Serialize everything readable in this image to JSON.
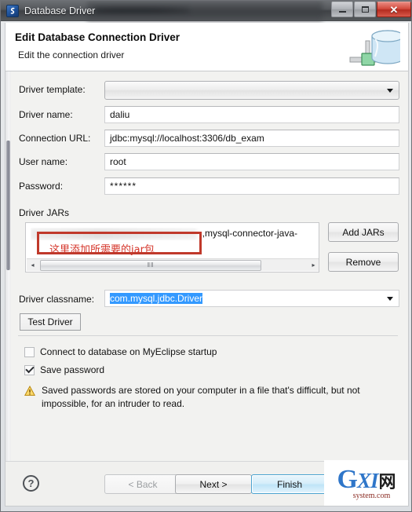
{
  "window": {
    "title": "Database Driver",
    "app_icon": "database-driver-icon",
    "controls": {
      "minimize": "–",
      "restore": "□",
      "close": "✕"
    }
  },
  "header": {
    "title": "Edit Database Connection Driver",
    "subtitle": "Edit the connection driver",
    "icon": "database-cylinder-icon"
  },
  "form": {
    "driver_template": {
      "label": "Driver template:",
      "value": "",
      "placeholder": ""
    },
    "driver_name": {
      "label": "Driver name:",
      "value": "daliu"
    },
    "connection_url": {
      "label": "Connection URL:",
      "value": "jdbc:mysql://localhost:3306/db_exam"
    },
    "user_name": {
      "label": "User name:",
      "value": "root"
    },
    "password": {
      "label": "Password:",
      "value": "******"
    }
  },
  "driver_jars": {
    "label": "Driver JARs",
    "entry": ",mysql-connector-java-",
    "add_button": "Add JARs",
    "remove_button": "Remove",
    "scroll_left": "◂",
    "scroll_right": "▸",
    "thumb_grip": "‖‖"
  },
  "driver_classname": {
    "label": "Driver classname:",
    "value": "com.mysql.jdbc.Driver"
  },
  "test_driver_button": "Test Driver",
  "options": {
    "connect_on_startup": {
      "label": "Connect to database on MyEclipse startup",
      "checked": false
    },
    "save_password": {
      "label": "Save password",
      "checked": true
    }
  },
  "warning": {
    "icon": "warning-triangle-icon",
    "text": "Saved passwords are stored on your computer in a file that's difficult, but not impossible, for an intruder to read."
  },
  "footer": {
    "help": "?",
    "back": "< Back",
    "next": "Next >",
    "finish": "Finish"
  },
  "annotation": {
    "text": "这里添加所需要的jar包",
    "color": "#c0392b"
  },
  "watermark": {
    "main_g": "G",
    "main_xi": "XI",
    "main_cn": "网",
    "sub": "system.com"
  }
}
